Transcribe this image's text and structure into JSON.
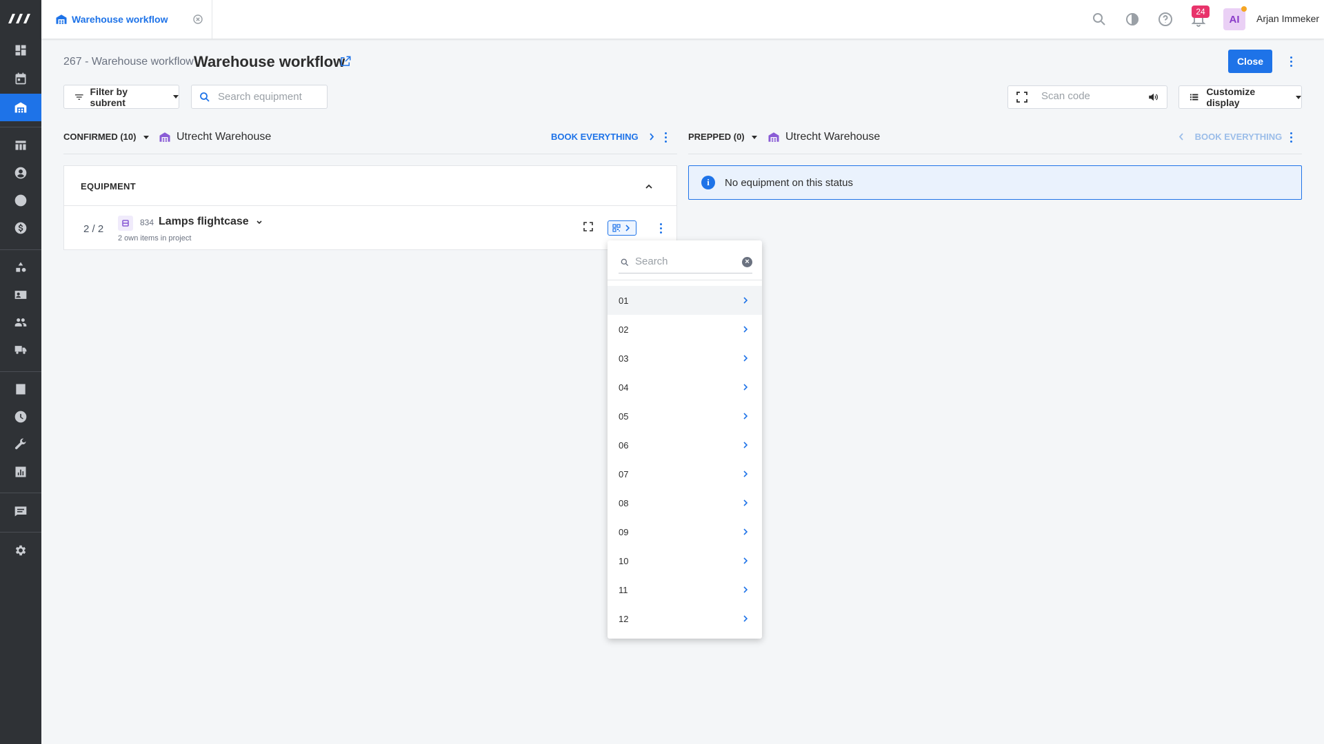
{
  "app": {
    "tab_label": "Warehouse workflow",
    "notification_count": "24",
    "user_initials": "AI",
    "user_name": "Arjan Immeker",
    "accent_color": "#1e73e8"
  },
  "sidebar": {
    "items": [
      {
        "name": "dashboard-icon"
      },
      {
        "name": "calendar-icon"
      },
      {
        "name": "warehouse-icon",
        "active": true
      },
      {
        "name": "table-icon"
      },
      {
        "name": "contacts-icon"
      },
      {
        "name": "sync-icon"
      },
      {
        "name": "dollar-icon"
      },
      {
        "name": "shapes-icon"
      },
      {
        "name": "id-card-icon"
      },
      {
        "name": "people-icon"
      },
      {
        "name": "truck-icon"
      },
      {
        "name": "task-icon"
      },
      {
        "name": "clock-icon"
      },
      {
        "name": "wrench-icon"
      },
      {
        "name": "chart-icon"
      },
      {
        "name": "messages-icon"
      },
      {
        "name": "settings-icon"
      }
    ]
  },
  "header": {
    "breadcrumb": "267 - Warehouse workflow",
    "title": "Warehouse workflow",
    "close_label": "Close"
  },
  "toolbar": {
    "filter_label": "Filter by subrent",
    "search_placeholder": "Search equipment",
    "scan_placeholder": "Scan code",
    "customize_label": "Customize display"
  },
  "left_column": {
    "status": "CONFIRMED (10)",
    "warehouse": "Utrecht Warehouse",
    "book_label": "BOOK EVERYTHING",
    "section_label": "EQUIPMENT",
    "item": {
      "count": "2 / 2",
      "number": "834",
      "name": "Lamps flightcase",
      "subtitle": "2 own items in project"
    }
  },
  "right_column": {
    "status": "PREPPED (0)",
    "warehouse": "Utrecht Warehouse",
    "book_label": "BOOK EVERYTHING",
    "info_message": "No equipment on this status"
  },
  "dropdown": {
    "search_placeholder": "Search",
    "items": [
      "01",
      "02",
      "03",
      "04",
      "05",
      "06",
      "07",
      "08",
      "09",
      "10",
      "11",
      "12"
    ]
  }
}
